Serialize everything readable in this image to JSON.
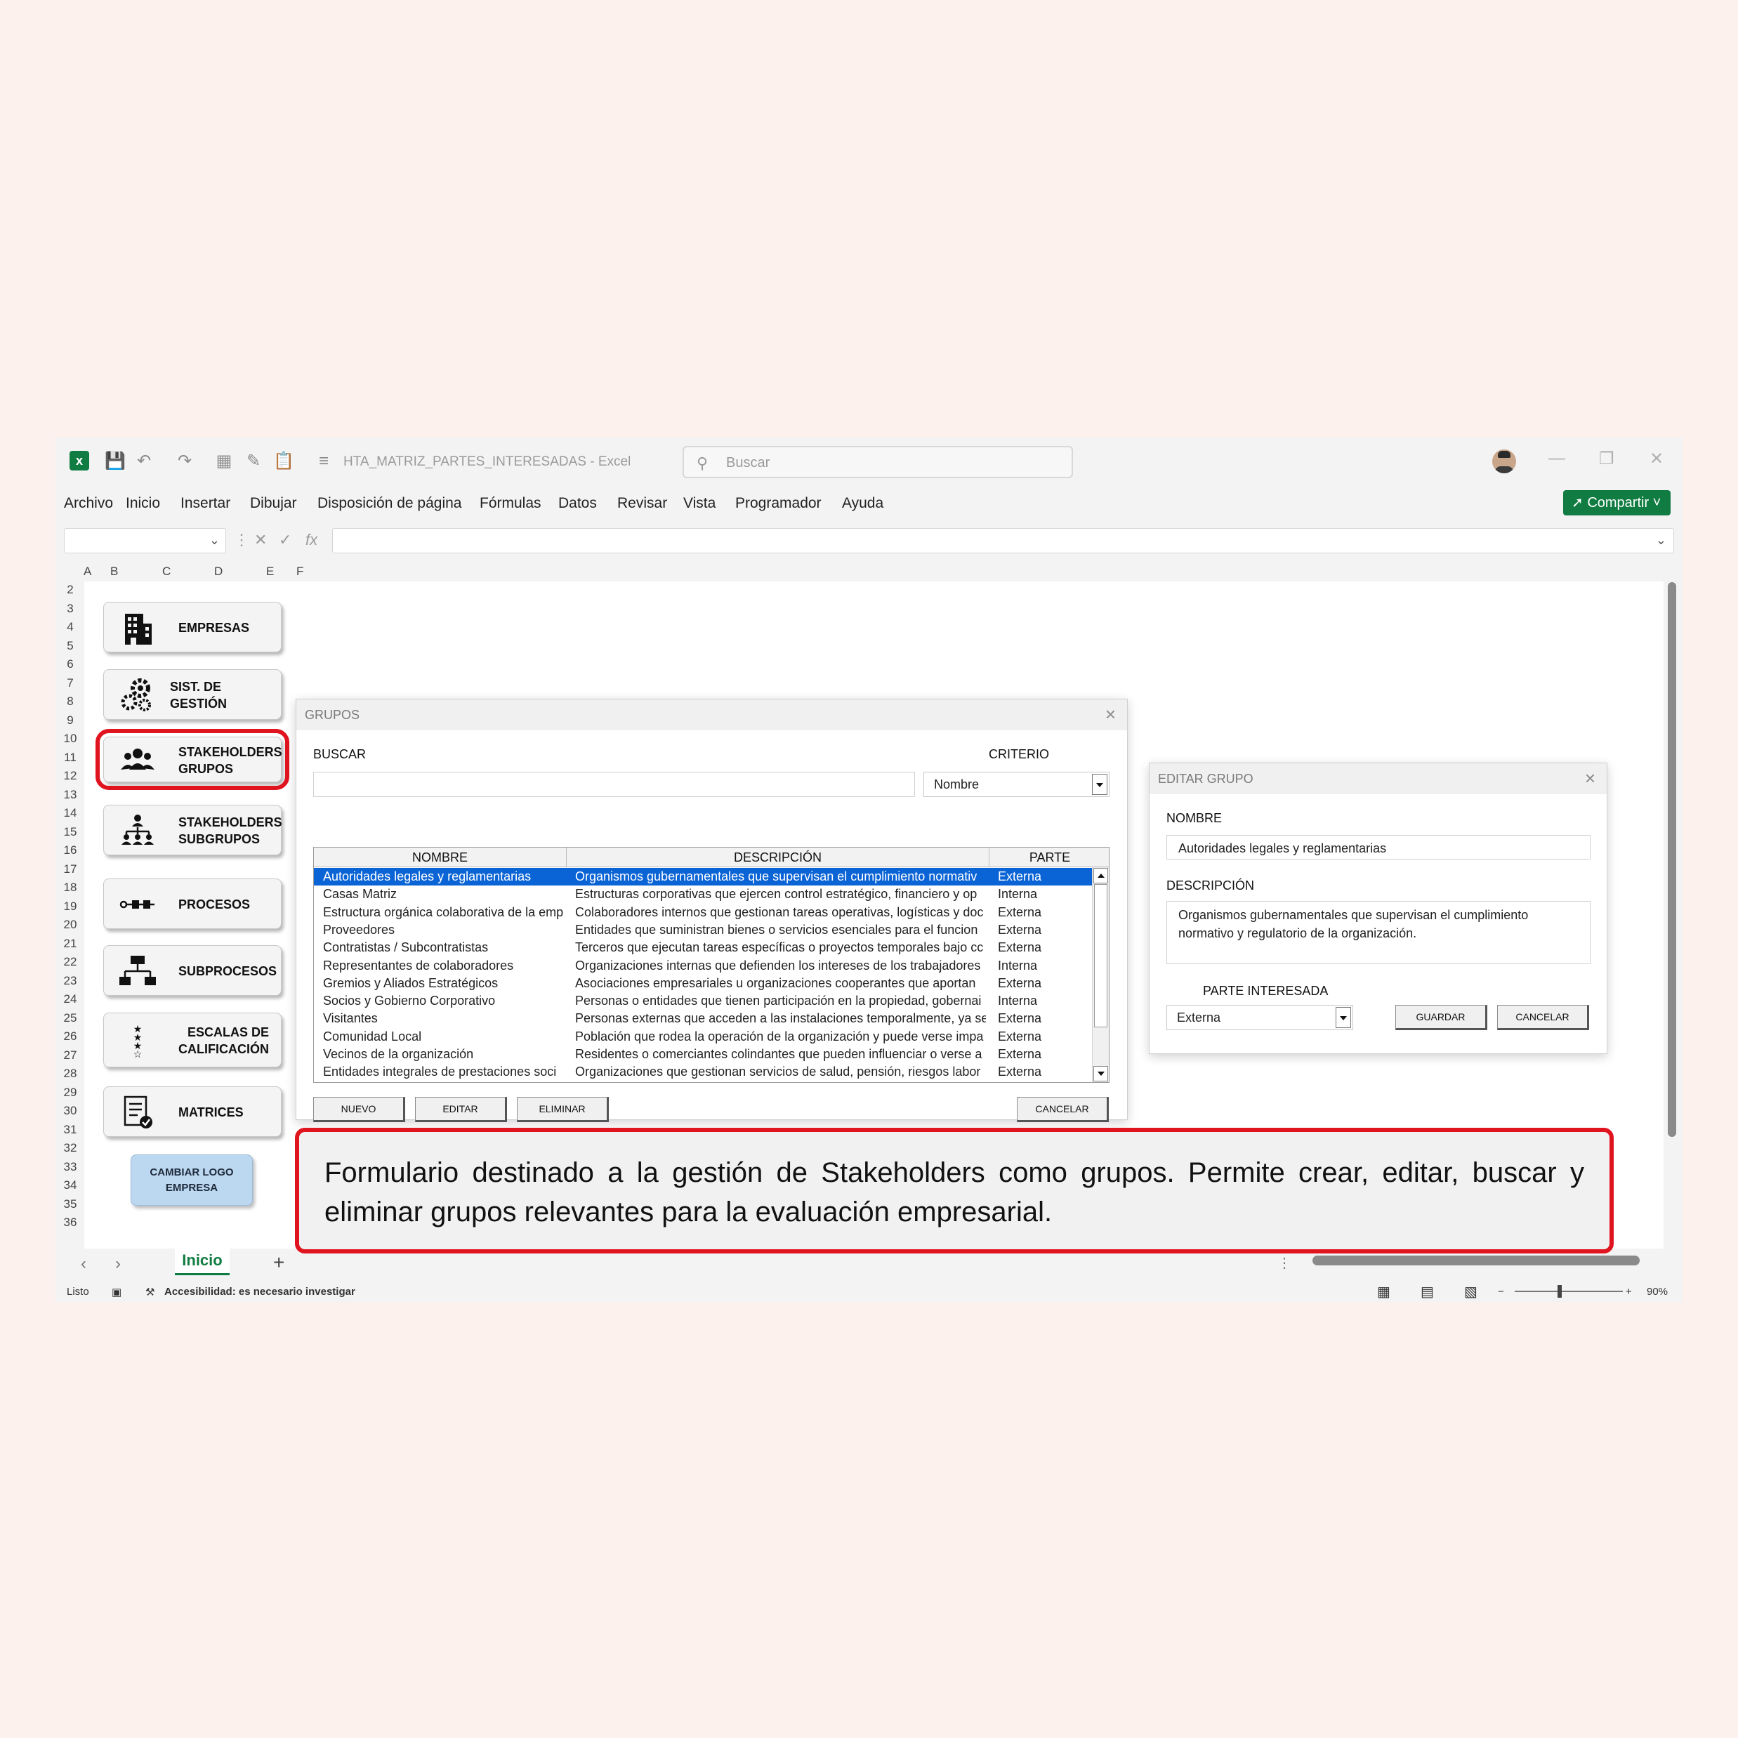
{
  "titlebar": {
    "doc_title": "HTA_MATRIZ_PARTES_INTERESADAS  -  Excel",
    "search_placeholder": "Buscar",
    "app_icon": "excel-icon"
  },
  "menu": {
    "items": [
      "Archivo",
      "Inicio",
      "Insertar",
      "Dibujar",
      "Disposición de página",
      "Fórmulas",
      "Datos",
      "Revisar",
      "Vista",
      "Programador",
      "Ayuda"
    ],
    "share_label": "Compartir"
  },
  "grid": {
    "columns": [
      "A",
      "B",
      "C",
      "D",
      "E",
      "F"
    ],
    "rows": [
      "2",
      "3",
      "4",
      "5",
      "6",
      "7",
      "8",
      "9",
      "10",
      "11",
      "12",
      "13",
      "14",
      "15",
      "16",
      "17",
      "18",
      "19",
      "20",
      "21",
      "22",
      "23",
      "24",
      "25",
      "26",
      "27",
      "28",
      "29",
      "30",
      "31",
      "32",
      "33",
      "34",
      "35",
      "36"
    ]
  },
  "nav_buttons": [
    {
      "line1": "EMPRESAS",
      "line2": "",
      "icon": "building-icon"
    },
    {
      "line1": "SIST. DE GESTIÓN",
      "line2": "",
      "icon": "gears-icon"
    },
    {
      "line1": "STAKEHOLDERS",
      "line2": "GRUPOS",
      "icon": "people-group-icon"
    },
    {
      "line1": "STAKEHOLDERS",
      "line2": "SUBGRUPOS",
      "icon": "hierarchy-people-icon"
    },
    {
      "line1": "PROCESOS",
      "line2": "",
      "icon": "process-flow-icon"
    },
    {
      "line1": "SUBPROCESOS",
      "line2": "",
      "icon": "org-chart-icon"
    },
    {
      "line1": "ESCALAS DE",
      "line2": "CALIFICACIÓN",
      "icon": "stars-icon"
    },
    {
      "line1": "MATRICES",
      "line2": "",
      "icon": "document-check-icon"
    }
  ],
  "logo_button": {
    "line1": "CAMBIAR LOGO",
    "line2": "EMPRESA"
  },
  "grupos_dialog": {
    "title": "GRUPOS",
    "search_label": "BUSCAR",
    "search_value": "",
    "criteria_label": "CRITERIO",
    "criteria_value": "Nombre",
    "columns": [
      "NOMBRE",
      "DESCRIPCIÓN",
      "PARTE"
    ],
    "rows": [
      [
        "Autoridades legales y reglamentarias",
        "Organismos gubernamentales que supervisan el cumplimiento normativ",
        "Externa"
      ],
      [
        "Casas Matriz",
        "Estructuras corporativas que ejercen control estratégico, financiero y op",
        "Interna"
      ],
      [
        "Estructura orgánica colaborativa de la emp",
        "Colaboradores internos que gestionan tareas operativas, logísticas y doc",
        "Externa"
      ],
      [
        "Proveedores",
        "Entidades que suministran bienes o servicios esenciales para el funcion",
        "Externa"
      ],
      [
        "Contratistas / Subcontratistas",
        "Terceros que ejecutan tareas específicas o proyectos temporales bajo cc",
        "Externa"
      ],
      [
        "Representantes de colaboradores",
        "Organizaciones internas que defienden los intereses de los trabajadores",
        "Interna"
      ],
      [
        "Gremios y Aliados Estratégicos",
        "Asociaciones empresariales u organizaciones cooperantes que aportan",
        "Externa"
      ],
      [
        "Socios y Gobierno Corporativo",
        "Personas o entidades que tienen participación en la propiedad, gobernai",
        "Interna"
      ],
      [
        "Visitantes",
        "Personas externas que acceden a las instalaciones temporalmente, ya se",
        "Externa"
      ],
      [
        "Comunidad Local",
        "Población que rodea la operación de la organización y puede verse impa",
        "Externa"
      ],
      [
        "Vecinos de la organización",
        "Residentes o comerciantes colindantes que pueden influenciar o verse a",
        "Externa"
      ],
      [
        "Entidades integrales de prestaciones soci",
        "Organizaciones que gestionan servicios de salud, pensión, riesgos labor",
        "Externa"
      ]
    ],
    "buttons": {
      "new": "NUEVO",
      "edit": "EDITAR",
      "delete": "ELIMINAR",
      "cancel": "CANCELAR"
    }
  },
  "editar_dialog": {
    "title": "EDITAR GRUPO",
    "name_label": "NOMBRE",
    "name_value": "Autoridades legales y reglamentarias",
    "desc_label": "DESCRIPCIÓN",
    "desc_value": "Organismos gubernamentales que supervisan el cumplimiento normativo y regulatorio de la organización.",
    "party_label": "PARTE INTERESADA",
    "party_value": "Externa",
    "save_label": "GUARDAR",
    "cancel_label": "CANCELAR"
  },
  "caption": "Formulario destinado a la gestión de Stakeholders como grupos. Permite crear, editar, buscar y eliminar grupos relevantes para la evaluación empresarial.",
  "sheet_tabs": {
    "active": "Inicio"
  },
  "status": {
    "ready": "Listo",
    "accessibility": "Accesibilidad: es necesario investigar",
    "zoom": "90%"
  },
  "colors": {
    "excel_green": "#107c41",
    "highlight_red": "#e0141e",
    "selection_blue": "#0a64d6"
  }
}
